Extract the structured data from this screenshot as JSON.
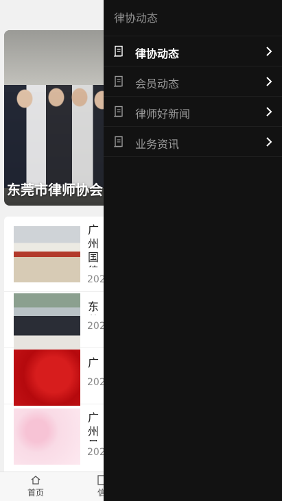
{
  "background": {
    "banner": {
      "title": "东莞市律师协会"
    },
    "news": [
      {
        "title": "广州国律研交",
        "date": "202"
      },
      {
        "title": "东莞",
        "date": "202"
      },
      {
        "title": "广州",
        "date": "202"
      },
      {
        "title": "广州量",
        "date": "202"
      }
    ],
    "bottom_nav": [
      {
        "label": "首页",
        "icon": "home-icon"
      },
      {
        "label": "信",
        "icon": "document-icon"
      }
    ]
  },
  "drawer": {
    "header": "律协动态",
    "items": [
      {
        "label": "律协动态",
        "icon": "document-icon",
        "active": true
      },
      {
        "label": "会员动态",
        "icon": "document-icon",
        "active": false
      },
      {
        "label": "律师好新闻",
        "icon": "document-icon",
        "active": false
      },
      {
        "label": "业务资讯",
        "icon": "document-icon",
        "active": false
      }
    ]
  },
  "colors": {
    "drawer_bg": "#121212",
    "active_text": "#ffffff",
    "inactive_text": "#9a9a9a"
  }
}
